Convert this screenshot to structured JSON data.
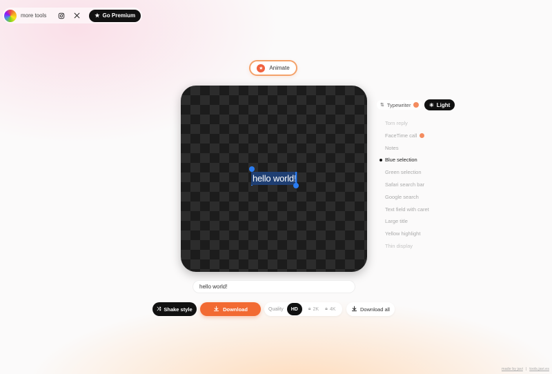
{
  "topbar": {
    "more_tools": "more tools",
    "instagram_icon": "instagram-icon",
    "x_icon": "x-icon",
    "premium_label": "Go Premium"
  },
  "animate": {
    "label": "Animate"
  },
  "canvas": {
    "text": "hello world!"
  },
  "panel": {
    "typewriter_label": "Typewriter",
    "light_label": "Light",
    "styles": [
      {
        "label": "Torn reply",
        "state": "faded"
      },
      {
        "label": "FaceTime call",
        "state": "normal",
        "badge": true
      },
      {
        "label": "Notes",
        "state": "normal"
      },
      {
        "label": "Blue selection",
        "state": "active"
      },
      {
        "label": "Green selection",
        "state": "normal"
      },
      {
        "label": "Safari search bar",
        "state": "normal"
      },
      {
        "label": "Google search",
        "state": "normal"
      },
      {
        "label": "Text field with caret",
        "state": "normal"
      },
      {
        "label": "Large title",
        "state": "normal"
      },
      {
        "label": "Yellow highlight",
        "state": "normal"
      },
      {
        "label": "Thin display",
        "state": "faded"
      }
    ]
  },
  "input": {
    "value": "hello world!"
  },
  "toolbar": {
    "shake_label": "Shake style",
    "download_label": "Download",
    "quality_label": "Quality",
    "hd_label": "HD",
    "q2k_label": "2K",
    "q4k_label": "4K",
    "download_all_label": "Download all"
  },
  "footer": {
    "made_by": "made by javi",
    "separator": "|",
    "domain": "tools.javi.es"
  },
  "colors": {
    "accent": "#f26a32",
    "selection": "#1f3f73",
    "caret": "#2a7cf0",
    "dark": "#111111"
  }
}
